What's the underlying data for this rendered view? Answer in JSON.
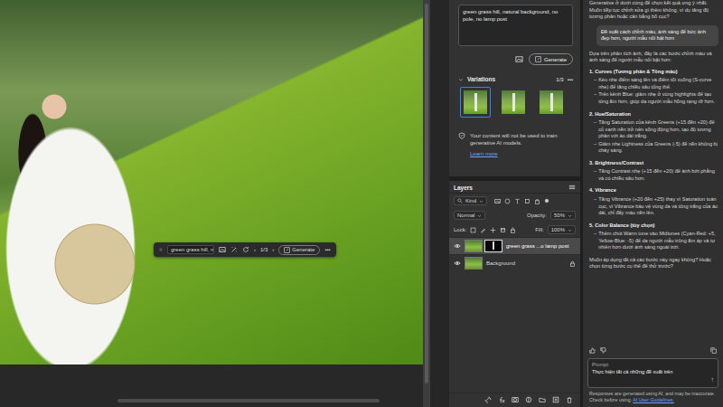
{
  "canvas": {
    "contextual_bar": {
      "prompt": "green grass hill, n",
      "prev": "‹",
      "counter": "1/3",
      "next": "›",
      "generate": "Generate",
      "more": "•••"
    }
  },
  "properties": {
    "prompt": "green grass hill, natural background, no pole, no lamp post",
    "generate": "Generate",
    "variations": {
      "title": "Variations",
      "counter": "1/3",
      "more": "•••",
      "items": [
        {
          "selected": true
        },
        {
          "selected": false
        },
        {
          "selected": false
        }
      ]
    },
    "notice": "Your content will not be used to train generative AI models.",
    "learn_more": "Learn more"
  },
  "layers": {
    "tab": "Layers",
    "filter": "Kind",
    "blend": "Normal",
    "opacity_label": "Opacity:",
    "opacity": "50%",
    "lock_label": "Lock:",
    "fill_label": "Fill:",
    "fill": "100%",
    "rows": [
      {
        "name": "green grass ...o lamp post",
        "visible": true,
        "selected": true,
        "kind": "generative"
      },
      {
        "name": "Background",
        "visible": true,
        "selected": false,
        "kind": "background"
      }
    ]
  },
  "assistant": {
    "prior": "Generative ở dưới cùng để chọn kết quả ưng ý nhất. Muốn tiếp tục chỉnh sửa gì thêm không, ví dụ tăng độ tương phản hoặc cân bằng bố cục?",
    "user_message": "Đề xuất cách chỉnh màu, ánh sáng để bức ảnh đẹp hơn, người mẫu nổi bật hơn",
    "intro": "Dựa trên phân tích ảnh, đây là các bước chỉnh màu và ánh sáng để người mẫu nổi bật hơn:",
    "bullet": "–",
    "sections": [
      {
        "title": "1. Curves (Tương phản & Tông màu)",
        "bullets": [
          "Kéo nhẹ điểm sáng lên và điểm tối xuống (S-curve nhẹ) để tăng chiều sâu tổng thể.",
          "Trên kênh Blue: giảm nhẹ ở vùng highlights để tạo tông ấm hơn, giúp da người mẫu hồng rạng rỡ hơn."
        ]
      },
      {
        "title": "2. Hue/Saturation",
        "bullets": [
          "Tăng Saturation của kênh Greens (+15 đến +20) để cỏ xanh nền trở nên sống động hơn, tạo độ tương phản với áo dài trắng.",
          "Giảm nhẹ Lightness của Greens (-5) để nền không bị cháy sáng."
        ]
      },
      {
        "title": "3. Brightness/Contrast",
        "bullets": [
          "Tăng Contrast nhẹ (+15 đến +20) để ảnh bớt phẳng và có chiều sâu hơn."
        ]
      },
      {
        "title": "4. Vibrance",
        "bullets": [
          "Tăng Vibrance (+20 đến +25) thay vì Saturation toàn cục, vì Vibrance bảo vệ vùng da và tông trắng của áo dài, chỉ đẩy màu nền lên."
        ]
      },
      {
        "title": "5. Color Balance (tùy chọn)",
        "bullets": [
          "Thêm chút Warm tone vào Midtones (Cyan-Red: +5, Yellow-Blue: -5) để da người mẫu trông ấm áp và tự nhiên hơn dưới ánh sáng ngoài trời."
        ]
      }
    ],
    "closing": "Muốn áp dụng tất cả các bước này ngay không? Hoặc chọn từng bước cụ thể để thử trước?",
    "input": {
      "label": "Prompt",
      "value": "Thực hiện tất cả những đề xuất trên",
      "send": "↑"
    },
    "disclaimer": "Responses are generated using AI, and may be inaccurate. Check before using.",
    "guidelines_link": "AI User Guidelines."
  }
}
